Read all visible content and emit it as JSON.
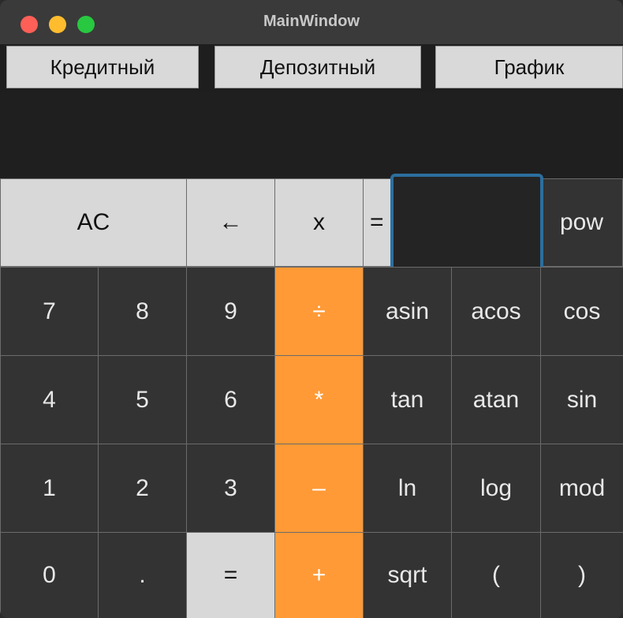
{
  "window": {
    "title": "MainWindow"
  },
  "tabs": [
    "Кредитный",
    "Депозитный",
    "График"
  ],
  "row0": {
    "ac": "AC",
    "back": "←",
    "x": "x",
    "eq": "=",
    "pow": "pow",
    "x_value": ""
  },
  "rows": [
    [
      "7",
      "8",
      "9",
      "÷",
      "asin",
      "acos",
      "cos"
    ],
    [
      "4",
      "5",
      "6",
      "*",
      "tan",
      "atan",
      "sin"
    ],
    [
      "1",
      "2",
      "3",
      "–",
      "ln",
      "log",
      "mod"
    ],
    [
      "0",
      ".",
      "=",
      "+",
      "sqrt",
      "(",
      ")"
    ]
  ],
  "colors": {
    "accent": "#ff9a36",
    "focus": "#2c6f9f"
  }
}
